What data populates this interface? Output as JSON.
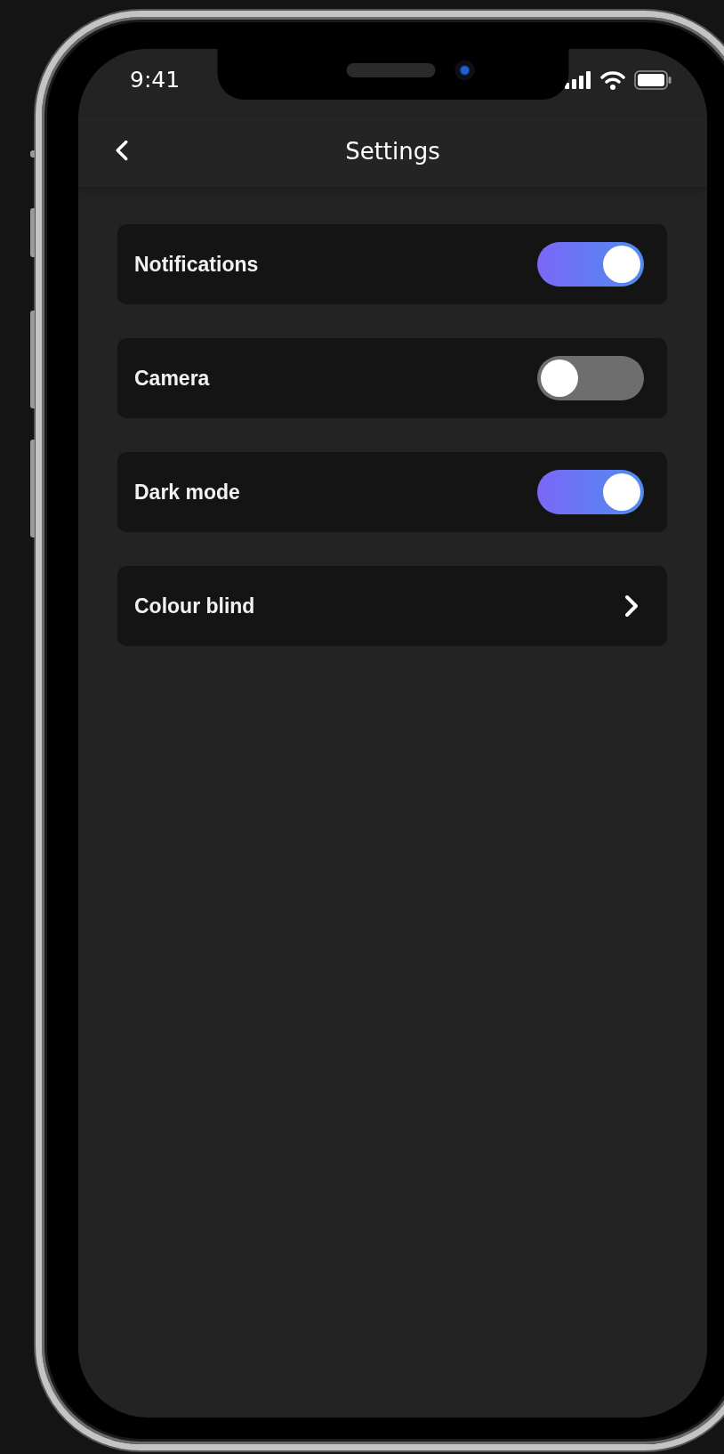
{
  "status_bar": {
    "time": "9:41"
  },
  "header": {
    "title": "Settings"
  },
  "settings": [
    {
      "kind": "toggle",
      "label": "Notifications",
      "on": true
    },
    {
      "kind": "toggle",
      "label": "Camera",
      "on": false
    },
    {
      "kind": "toggle",
      "label": "Dark mode",
      "on": true
    },
    {
      "kind": "link",
      "label": "Colour blind"
    }
  ]
}
